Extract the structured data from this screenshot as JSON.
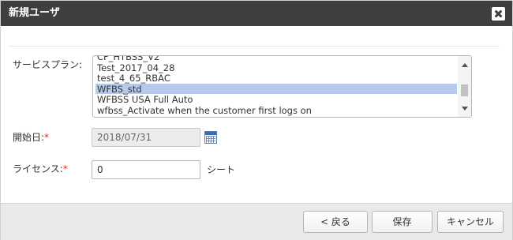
{
  "dialog": {
    "title": "新規ユーザ"
  },
  "form": {
    "service_plan": {
      "label": "サービスプラン:",
      "options": [
        "CF_HTBSS_V2",
        "Test_2017_04_28",
        "test_4_65_RBAC",
        "WFBS_std",
        "WFBSS USA Full Auto",
        "wfbss_Activate when the customer first logs on"
      ],
      "selected": "WFBS_std"
    },
    "start_date": {
      "label": "開始日:",
      "required_mark": "*",
      "value": "2018/07/31"
    },
    "license": {
      "label": "ライセンス:",
      "required_mark": "*",
      "value": "0",
      "unit": "シート"
    }
  },
  "footer": {
    "back_label": "< 戻る",
    "save_label": "保存",
    "cancel_label": "キャンセル"
  }
}
